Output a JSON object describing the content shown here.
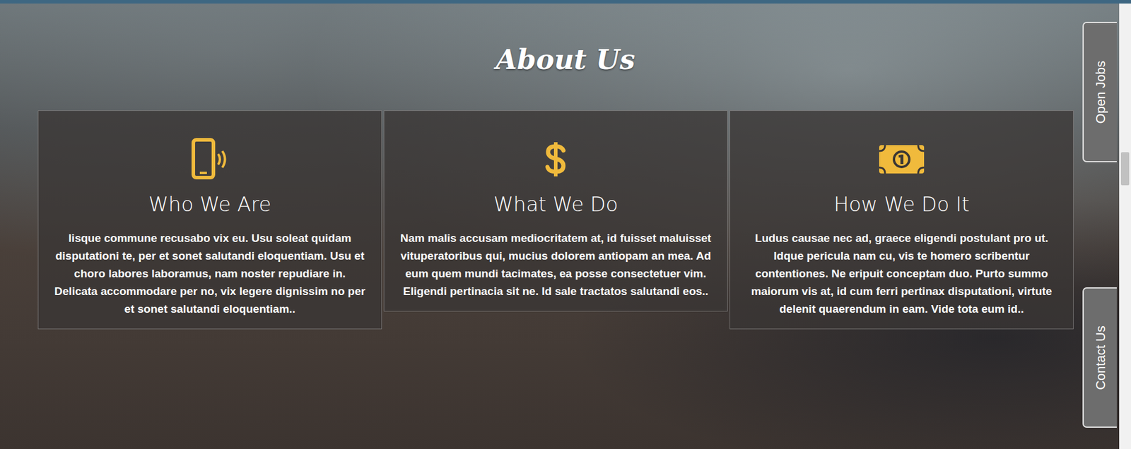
{
  "section": {
    "title": "About Us"
  },
  "features": [
    {
      "kind": "phone",
      "heading": "Who We Are",
      "body": "lisque commune recusabo vix eu. Usu soleat quidam disputationi te, per et sonet salutandi eloquentiam. Usu et choro labores laboramus, nam noster repudiare in. Delicata accommodare per no, vix legere dignissim no per et sonet salutandi eloquentiam.."
    },
    {
      "kind": "dollar",
      "heading": "What We Do",
      "body": "Nam malis accusam mediocritatem at, id fuisset maluisset vituperatoribus qui, mucius dolorem antiopam an mea. Ad eum quem mundi tacimates, ea posse consectetuer vim. Eligendi pertinacia sit ne. Id sale tractatos salutandi eos.."
    },
    {
      "kind": "bill",
      "heading": "How We Do It",
      "body": "Ludus causae nec ad, graece eligendi postulant pro ut. Idque pericula nam cu, vis te homero scribentur contentiones. Ne eripuit conceptam duo. Purto summo maiorum vis at, id cum ferri pertinax disputationi, virtute delenit quaerendum in eam. Vide tota eum id.."
    }
  ],
  "side_tabs": [
    {
      "label": "Open Jobs"
    },
    {
      "label": "Contact Us"
    }
  ]
}
